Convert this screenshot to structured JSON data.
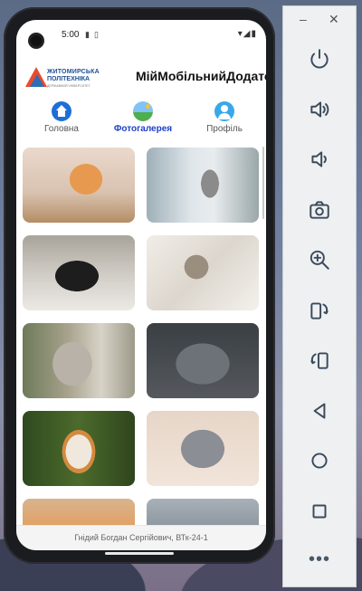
{
  "status": {
    "time": "5:00"
  },
  "app": {
    "title": "МійМобільнийДодаток",
    "logo": {
      "line1": "ЖИТОМИРСЬКА",
      "line2": "ПОЛІТЕХНІКА",
      "line3": "ДЕРЖАВНИЙ УНІВЕРСИТЕТ"
    }
  },
  "tabs": [
    {
      "label": "Головна",
      "icon": "home-icon",
      "active": false
    },
    {
      "label": "Фотогалерея",
      "icon": "gallery-icon",
      "active": true
    },
    {
      "label": "Профіль",
      "icon": "profile-icon",
      "active": false
    }
  ],
  "gallery": {
    "items": [
      "cat-photo-1",
      "cat-photo-2",
      "cat-photo-3",
      "cat-photo-4",
      "cat-photo-5",
      "cat-photo-6",
      "cat-photo-7",
      "cat-photo-8",
      "cat-photo-9",
      "cat-photo-10"
    ]
  },
  "footer": {
    "text": "Гнідий Богдан Сергійович, ВТк-24-1"
  },
  "emulator_toolbar": {
    "window_controls": {
      "minimize": "–",
      "close": "✕"
    },
    "buttons": [
      "power-icon",
      "volume-up-icon",
      "volume-down-icon",
      "camera-icon",
      "zoom-icon",
      "rotate-left-icon",
      "rotate-right-icon",
      "back-icon",
      "home-icon",
      "overview-icon"
    ],
    "more": "•••"
  },
  "colors": {
    "accent": "#1e3fc9",
    "home_icon": "#1e6fd6",
    "profile_icon": "#3aa8e8"
  }
}
